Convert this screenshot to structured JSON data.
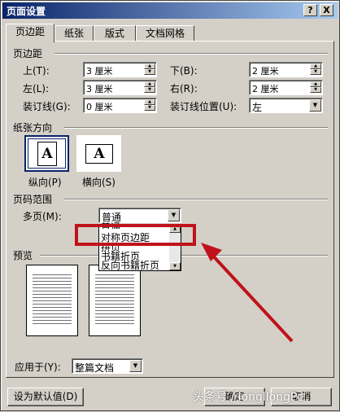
{
  "window": {
    "title": "页面设置",
    "help": "?",
    "close": "X"
  },
  "tabs": [
    "页边距",
    "纸张",
    "版式",
    "文档网格"
  ],
  "margins": {
    "section": "页边距",
    "top_label": "上(T):",
    "top_value": "3 厘米",
    "bottom_label": "下(B):",
    "bottom_value": "2 厘米",
    "left_label": "左(L):",
    "left_value": "3 厘米",
    "right_label": "右(R):",
    "right_value": "2 厘米",
    "gutter_label": "装订线(G):",
    "gutter_value": "0 厘米",
    "gutter_pos_label": "装订线位置(U):",
    "gutter_pos_value": "左"
  },
  "orientation": {
    "section": "纸张方向",
    "portrait": "纵向(P)",
    "landscape": "横向(S)",
    "glyph": "A"
  },
  "pages": {
    "section": "页码范围",
    "multi_label": "多页(M):",
    "multi_value": "普通",
    "options": [
      "普通",
      "对称页边距",
      "拼页",
      "书籍折页",
      "反向书籍折页"
    ],
    "highlighted": "对称页边距"
  },
  "preview": {
    "section": "预览",
    "apply_label": "应用于(Y):",
    "apply_value": "整篇文档"
  },
  "buttons": {
    "default": "设为默认值(D)",
    "ok": "确定",
    "cancel": "取消"
  },
  "watermark": "头条号 / longllongPc",
  "annotation": {
    "color": "#c0121a"
  }
}
